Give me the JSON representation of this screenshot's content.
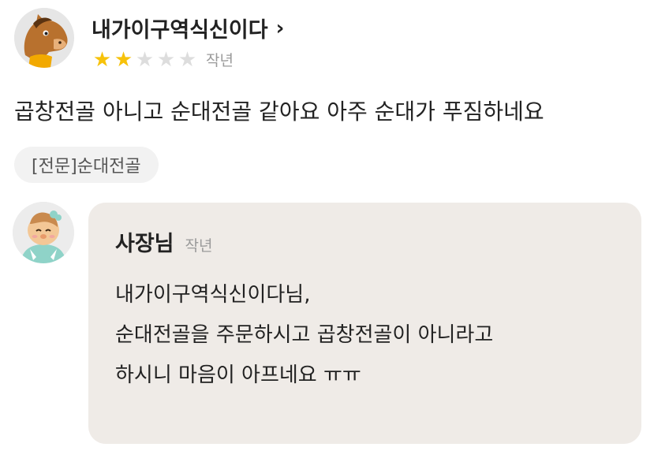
{
  "review": {
    "reviewer_name": "내가이구역식신이다",
    "chevron_glyph": "›",
    "rating": 2,
    "rating_max": 5,
    "star_glyph": "★",
    "date": "작년",
    "text": "곱창전골 아니고 순대전골 같아요 아주 순대가 푸짐하네요",
    "menu_tag": "[전문]순대전골"
  },
  "reply": {
    "owner_name": "사장님",
    "date": "작년",
    "lines": [
      "내가이구역식신이다님,",
      "순대전골을 주문하시고 곱창전골이 아니라고",
      "하시니 마음이 아프네요 ㅠㅠ"
    ]
  },
  "icons": {
    "reviewer_avatar": "horse-character-avatar-icon",
    "owner_avatar": "owner-character-avatar-icon",
    "chevron": "chevron-right-icon",
    "star": "star-icon"
  },
  "colors": {
    "star_filled": "#f7c20a",
    "star_empty": "#dddddd",
    "reply_bubble": "#efebe7",
    "tag_background": "#f2f2f2",
    "muted_text": "#9a9a9a"
  }
}
